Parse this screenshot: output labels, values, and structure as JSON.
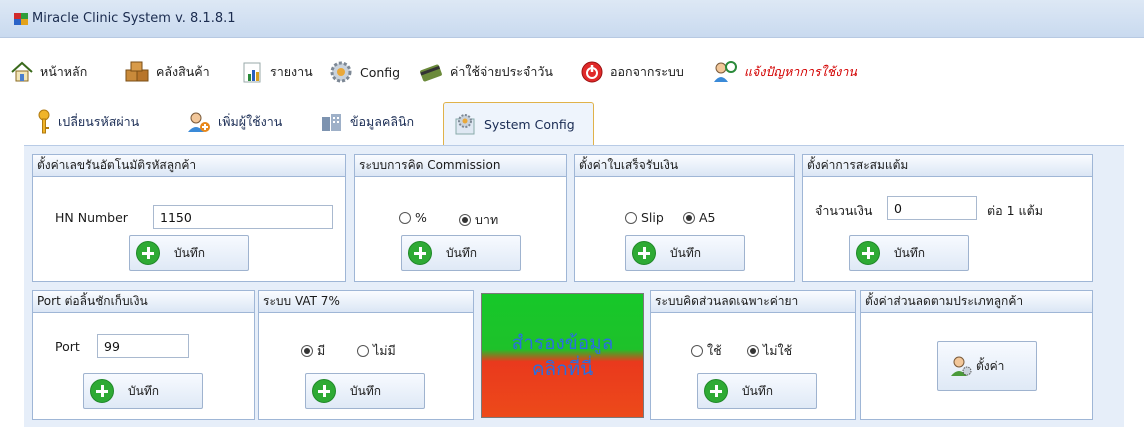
{
  "window": {
    "title": "Miracle Clinic System v. 8.1.8.1"
  },
  "menu": {
    "home": "หน้าหลัก",
    "inventory": "คลังสินค้า",
    "reports": "รายงาน",
    "config": "Config",
    "daily_expense": "ค่าใช้จ่ายประจำวัน",
    "logout": "ออกจากระบบ",
    "report_problem": "แจ้งปัญหาการใช้งาน"
  },
  "tabs": [
    {
      "label": "เปลี่ยนรหัสผ่าน",
      "active": false
    },
    {
      "label": "เพิ่มผู้ใช้งาน",
      "active": false
    },
    {
      "label": "ข้อมูลคลินิก",
      "active": false
    },
    {
      "label": "System Config",
      "active": true
    }
  ],
  "panels": {
    "hn": {
      "title": "ตั้งค่าเลขรันอัตโนมัติรหัสลูกค้า",
      "field_label": "HN Number",
      "value": "1150",
      "button": "บันทึก"
    },
    "commission": {
      "title": "ระบบการคิด  Commission",
      "option_percent": "%",
      "option_baht": "บาท",
      "selected": "บาท",
      "button": "บันทึก"
    },
    "receipt": {
      "title": "ตั้งค่าใบเสร็จรับเงิน",
      "option_slip": "Slip",
      "option_a5": "A5",
      "selected": "A5",
      "button": "บันทึก"
    },
    "points": {
      "title": "ตั้งค่าการสะสมแต้ม",
      "amount_label": "จำนวนเงิน",
      "amount_value": "0",
      "per_label": "ต่อ 1 แต้ม",
      "button": "บันทึก"
    },
    "port": {
      "title": "Port ต่อลิ้นชักเก็บเงิน",
      "field_label": "Port",
      "value": "99",
      "button": "บันทึก"
    },
    "vat": {
      "title": "ระบบ VAT 7%",
      "option_yes": "มี",
      "option_no": "ไม่มี",
      "selected": "มี",
      "button": "บันทึก"
    },
    "backup": {
      "line1": "สำรองข้อมูล",
      "line2": "คลิกที่นี่"
    },
    "item_discount": {
      "title": "ระบบคิดส่วนลดเฉพาะค่ายา",
      "option_use": "ใช้",
      "option_not_use": "ไม่ใช้",
      "selected": "ไม่ใช้",
      "button": "บันทึก"
    },
    "customer_discount": {
      "title": "ตั้งค่าส่วนลดตามประเภทลูกค้า",
      "button": "ตั้งค่า"
    }
  },
  "colors": {
    "accent_green": "#2eaa34",
    "backup_green": "#1ec12a",
    "backup_red": "#ed4a1a",
    "backup_text": "#2a6ee0",
    "report_red": "#d30000"
  },
  "icons": [
    "home-icon",
    "boxes-icon",
    "chart-icon",
    "gear-icon",
    "card-icon",
    "power-icon",
    "user-help-icon",
    "key-icon",
    "add-user-icon",
    "building-icon",
    "config-icon",
    "plus-icon",
    "user-settings-icon"
  ]
}
